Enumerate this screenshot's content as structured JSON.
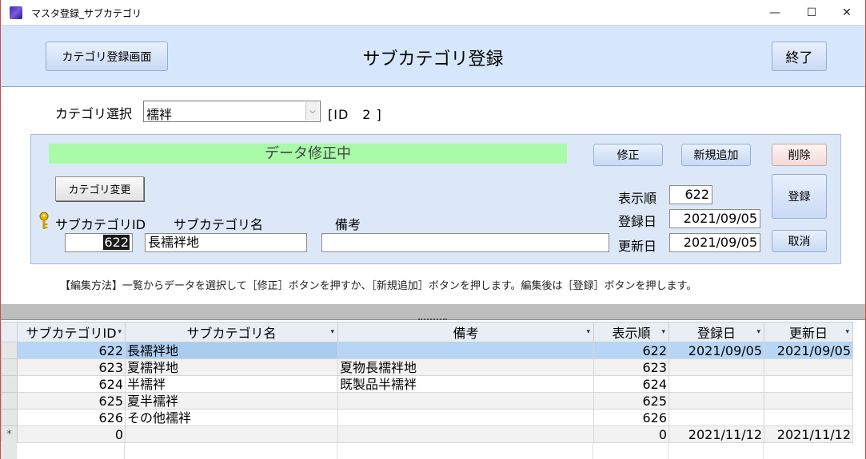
{
  "window": {
    "title": "マスタ登録_サブカテゴリ",
    "minimize_glyph": "—",
    "maximize_glyph": "☐",
    "close_glyph": "✕"
  },
  "header": {
    "category_screen_button": "カテゴリ登録画面",
    "title": "サブカテゴリ登録",
    "exit_button": "終了"
  },
  "category": {
    "label": "カテゴリ選択",
    "selected_value": "襦袢",
    "id_text": "[ID　2 ]"
  },
  "edit_panel": {
    "status": "データ修正中",
    "status_color": "#a9fba9",
    "buttons": {
      "modify": "修正",
      "add_new": "新規追加",
      "delete": "削除",
      "register": "登録",
      "cancel": "取消",
      "change_category": "カテゴリ変更"
    },
    "labels": {
      "subcategory_id": "サブカテゴリID",
      "subcategory_name": "サブカテゴリ名",
      "remarks": "備考",
      "display_order": "表示順",
      "registered_date": "登録日",
      "updated_date": "更新日"
    },
    "values": {
      "subcategory_id": "622",
      "subcategory_name": "長襦袢地",
      "remarks": "",
      "display_order": "622",
      "registered_date": "2021/09/05",
      "updated_date": "2021/09/05"
    }
  },
  "help_text": "【編集方法】一覧からデータを選択して［修正］ボタンを押すか、［新規追加］ボタンを押します。編集後は［登録］ボタンを押します。",
  "datasheet": {
    "columns": [
      "サブカテゴリID",
      "サブカテゴリ名",
      "備考",
      "表示順",
      "登録日",
      "更新日"
    ],
    "sort_glyph": "▾",
    "new_row_glyph": "*",
    "rows": [
      {
        "id": "622",
        "name": "長襦袢地",
        "remarks": "",
        "order": "622",
        "registered": "2021/09/05",
        "updated": "2021/09/05"
      },
      {
        "id": "623",
        "name": "夏襦袢地",
        "remarks": "夏物長襦袢地",
        "order": "623",
        "registered": "",
        "updated": ""
      },
      {
        "id": "624",
        "name": "半襦袢",
        "remarks": "既製品半襦袢",
        "order": "624",
        "registered": "",
        "updated": ""
      },
      {
        "id": "625",
        "name": "夏半襦袢",
        "remarks": "",
        "order": "625",
        "registered": "",
        "updated": ""
      },
      {
        "id": "626",
        "name": "その他襦袢",
        "remarks": "",
        "order": "626",
        "registered": "",
        "updated": ""
      }
    ],
    "new_row": {
      "id": "0",
      "name": "",
      "remarks": "",
      "order": "0",
      "registered": "2021/11/12",
      "updated": "2021/11/12"
    }
  },
  "colors": {
    "header_band": "#d6e6fb",
    "panel": "#dce8f8",
    "selected_row": "#b7d6f5"
  }
}
